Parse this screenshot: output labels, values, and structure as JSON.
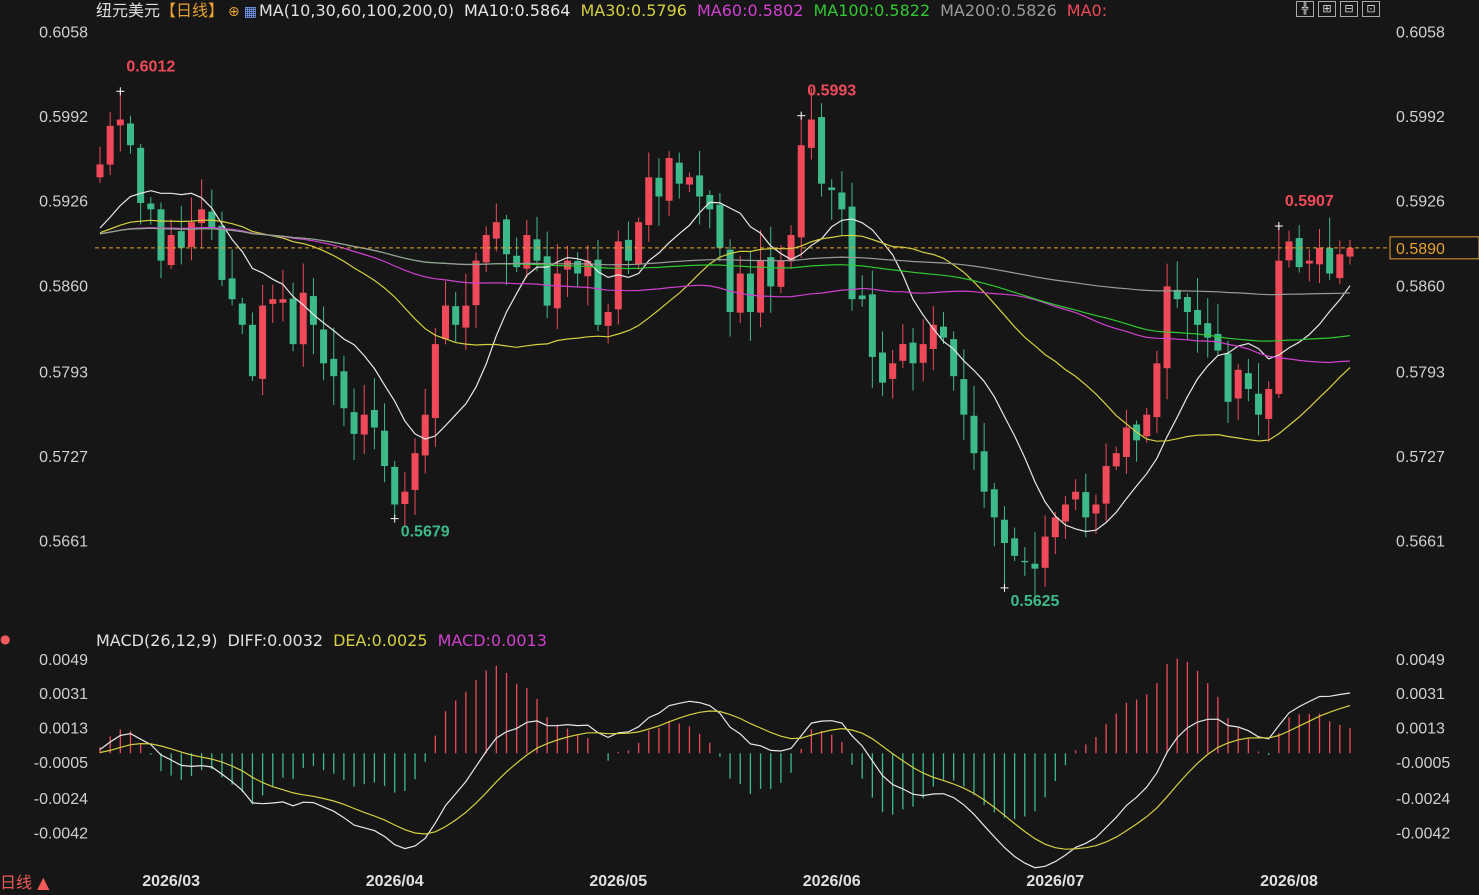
{
  "header": {
    "symbol": "纽元美元",
    "period_tag": "【日线】",
    "ma_params": "MA(10,30,60,100,200,0)",
    "ma10": "MA10:0.5864",
    "ma30": "MA30:0.5796",
    "ma60": "MA60:0.5802",
    "ma100": "MA100:0.5822",
    "ma200": "MA200:0.5826",
    "ma0": "MA0:"
  },
  "macd_header": {
    "params": "MACD(26,12,9)",
    "diff": "DIFF:0.0032",
    "dea": "DEA:0.0025",
    "macd": "MACD:0.0013"
  },
  "period_button": "日线 ▲",
  "colors": {
    "background": "#161616",
    "up": "#f04a5a",
    "down": "#3dba8a",
    "ma10": "#e8e8e8",
    "ma30": "#d4d040",
    "ma60": "#d040d0",
    "ma100": "#30c830",
    "ma200": "#9a9a9a",
    "current_price_box": "#e8a030"
  },
  "chart_data": {
    "type": "candlestick",
    "price_axis_ticks": [
      "0.6058",
      "0.5992",
      "0.5926",
      "0.5860",
      "0.5793",
      "0.5727",
      "0.5661"
    ],
    "price_range": [
      0.56,
      0.6066
    ],
    "current_price": "0.5890",
    "annotations": [
      {
        "label": "0.6012",
        "type": "high",
        "bar_index": 2,
        "price": 0.6012
      },
      {
        "label": "0.5679",
        "type": "low",
        "bar_index": 29,
        "price": 0.5679
      },
      {
        "label": "0.5993",
        "type": "high",
        "bar_index": 69,
        "price": 0.5993
      },
      {
        "label": "0.5625",
        "type": "low",
        "bar_index": 89,
        "price": 0.5625
      },
      {
        "label": "0.5907",
        "type": "high",
        "bar_index": 116,
        "price": 0.5907
      }
    ],
    "x_axis_labels": [
      {
        "label": "2026/03",
        "bar_index": 7
      },
      {
        "label": "2026/04",
        "bar_index": 29
      },
      {
        "label": "2026/05",
        "bar_index": 51
      },
      {
        "label": "2026/06",
        "bar_index": 72
      },
      {
        "label": "2026/07",
        "bar_index": 94
      },
      {
        "label": "2026/08",
        "bar_index": 117
      }
    ],
    "candles_close": [
      0.5955,
      0.5985,
      0.599,
      0.597,
      0.5925,
      0.592,
      0.588,
      0.59,
      0.589,
      0.591,
      0.592,
      0.5905,
      0.5865,
      0.585,
      0.583,
      0.579,
      0.5845,
      0.585,
      0.585,
      0.5815,
      0.5855,
      0.583,
      0.58,
      0.579,
      0.5765,
      0.5745,
      0.576,
      0.575,
      0.572,
      0.569,
      0.57,
      0.573,
      0.576,
      0.5815,
      0.5845,
      0.583,
      0.5845,
      0.588,
      0.59,
      0.591,
      0.5885,
      0.5875,
      0.59,
      0.588,
      0.5845,
      0.587,
      0.588,
      0.587,
      0.588,
      0.583,
      0.584,
      0.5895,
      0.588,
      0.591,
      0.5945,
      0.593,
      0.596,
      0.594,
      0.5945,
      0.593,
      0.592,
      0.589,
      0.584,
      0.587,
      0.584,
      0.588,
      0.586,
      0.588,
      0.59,
      0.597,
      0.599,
      0.594,
      0.5935,
      0.592,
      0.585,
      0.585,
      0.5805,
      0.5785,
      0.58,
      0.5815,
      0.58,
      0.5815,
      0.583,
      0.582,
      0.579,
      0.576,
      0.573,
      0.57,
      0.568,
      0.566,
      0.565,
      0.5645,
      0.564,
      0.5665,
      0.568,
      0.569,
      0.57,
      0.568,
      0.569,
      0.572,
      0.573,
      0.575,
      0.574,
      0.576,
      0.58,
      0.586,
      0.585,
      0.584,
      0.583,
      0.582,
      0.581,
      0.577,
      0.5795,
      0.578,
      0.576,
      0.578,
      0.588,
      0.5895,
      0.5875,
      0.588,
      0.589,
      0.587,
      0.5885,
      0.589
    ],
    "macd_axis_ticks": [
      "0.0049",
      "0.0031",
      "0.0013",
      "-0.0005",
      "-0.0024",
      "-0.0042"
    ],
    "macd_range": [
      -0.0057,
      0.0051
    ]
  }
}
